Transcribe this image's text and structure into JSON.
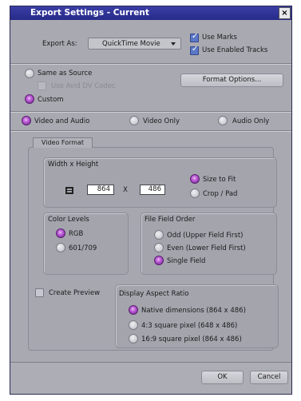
{
  "window": {
    "title": "Export Settings - Current",
    "close_glyph": "×"
  },
  "export": {
    "export_as_label": "Export As:",
    "export_as_value": "QuickTime Movie",
    "use_marks": {
      "label": "Use Marks",
      "checked": true
    },
    "use_enabled_tracks": {
      "label": "Use Enabled Tracks",
      "checked": true
    }
  },
  "source": {
    "same_as_source": {
      "label": "Same as Source",
      "selected": false
    },
    "use_avid_dv_codec": {
      "label": "Use Avid DV Codec",
      "checked": false,
      "disabled": true
    },
    "custom": {
      "label": "Custom",
      "selected": true
    },
    "format_options_button": "Format Options..."
  },
  "av_mode": {
    "options": [
      {
        "label": "Video and Audio",
        "selected": true
      },
      {
        "label": "Video Only",
        "selected": false
      },
      {
        "label": "Audio Only",
        "selected": false
      }
    ]
  },
  "tabs": {
    "video_format": "Video Format"
  },
  "width_height": {
    "title": "Width x Height",
    "width": "864",
    "separator": "X",
    "height": "486",
    "size_to_fit": {
      "label": "Size to Fit",
      "selected": true
    },
    "crop_pad": {
      "label": "Crop / Pad",
      "selected": false
    },
    "icon": "frame-size-icon"
  },
  "color_levels": {
    "title": "Color Levels",
    "options": [
      {
        "label": "RGB",
        "selected": true
      },
      {
        "label": "601/709",
        "selected": false
      }
    ]
  },
  "field_order": {
    "title": "File Field Order",
    "options": [
      {
        "label": "Odd (Upper Field First)",
        "selected": false
      },
      {
        "label": "Even (Lower Field First)",
        "selected": false
      },
      {
        "label": "Single Field",
        "selected": true
      }
    ]
  },
  "create_preview": {
    "label": "Create Preview",
    "checked": false
  },
  "aspect_ratio": {
    "title": "Display Aspect Ratio",
    "options": [
      {
        "label": "Native dimensions  (864 x 486)",
        "selected": true
      },
      {
        "label": "4:3 square pixel    (648 x 486)",
        "selected": false
      },
      {
        "label": "16:9 square pixel  (864 x 486)",
        "selected": false
      }
    ]
  },
  "buttons": {
    "ok": "OK",
    "cancel": "Cancel"
  },
  "colors": {
    "title_bar": "#262a88",
    "dialog_bg": "#a9a9b1",
    "radio_selected": "#c060d8",
    "check_accent": "#5a78c6"
  }
}
